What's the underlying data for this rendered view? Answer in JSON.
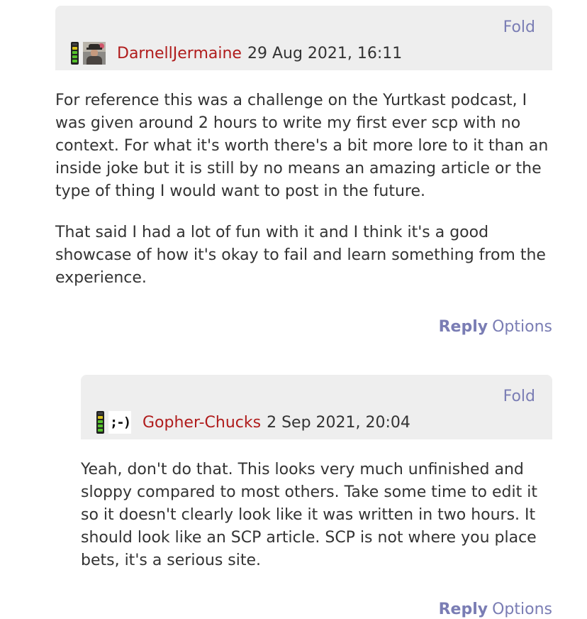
{
  "comments": [
    {
      "fold_label": "Fold",
      "author": "DarnellJermaine",
      "date": "29 Aug 2021, 16:11",
      "avatar_icon": "user-photo-icon",
      "paragraphs": [
        "For reference this was a challenge on the Yurtkast podcast, I was given around 2 hours to write my first ever scp with no context. For what it's worth there's a bit more lore to it than an inside joke but it is still by no means an amazing article or the type of thing I would want to post in the future.",
        "That said I had a lot of fun with it and I think it's a good showcase of how it's okay to fail and learn something from the experience."
      ],
      "reply_label": "Reply",
      "options_label": "Options"
    },
    {
      "fold_label": "Fold",
      "author": "Gopher-Chucks",
      "date": "2 Sep 2021, 20:04",
      "avatar_text": ";-)",
      "paragraphs": [
        "Yeah, don't do that. This looks very much unfinished and sloppy compared to most others. Take some time to edit it so it doesn't clearly look like it was written in two hours. It should look like an SCP article. SCP is not where you place bets, it's a serious site."
      ],
      "reply_label": "Reply",
      "options_label": "Options"
    }
  ],
  "colors": {
    "header_bg": "#eeeeee",
    "author_link": "#b01c1c",
    "action_link": "#7a7db4",
    "text": "#333333"
  }
}
